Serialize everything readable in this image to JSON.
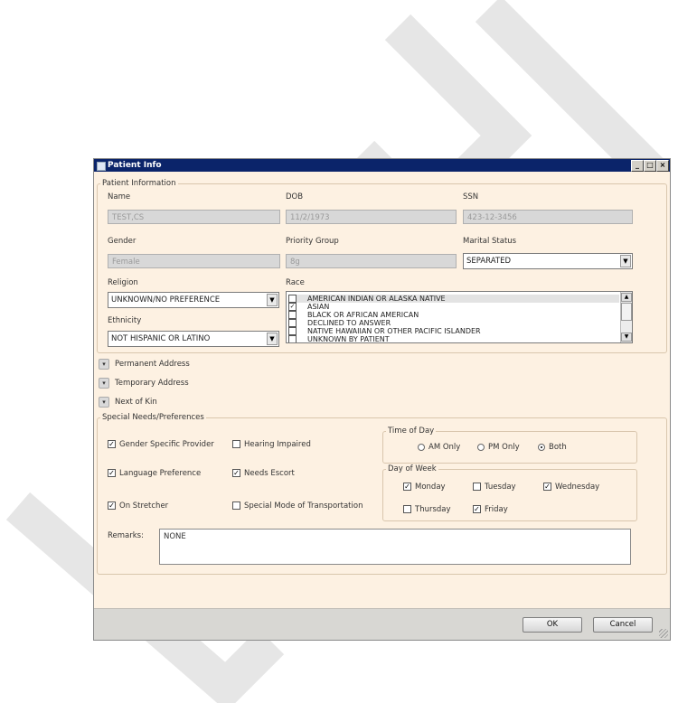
{
  "window": {
    "title": "Patient Info",
    "controls": {
      "minimize": "_",
      "maximize": "□",
      "close": "×"
    }
  },
  "patient_information": {
    "group_title": "Patient Information",
    "name_label": "Name",
    "name_value": "TEST,CS",
    "dob_label": "DOB",
    "dob_value": "11/2/1973",
    "ssn_label": "SSN",
    "ssn_value": "423-12-3456",
    "gender_label": "Gender",
    "gender_value": "Female",
    "priority_label": "Priority Group",
    "priority_value": "8g",
    "marital_label": "Marital Status",
    "marital_value": "SEPARATED",
    "religion_label": "Religion",
    "religion_value": "UNKNOWN/NO PREFERENCE",
    "ethnicity_label": "Ethnicity",
    "ethnicity_value": "NOT HISPANIC OR LATINO",
    "race_label": "Race",
    "race_options": [
      {
        "label": "AMERICAN INDIAN OR ALASKA NATIVE",
        "checked": false,
        "mark": ""
      },
      {
        "label": "ASIAN",
        "checked": true,
        "mark": "✓"
      },
      {
        "label": "BLACK OR AFRICAN AMERICAN",
        "checked": false,
        "mark": ""
      },
      {
        "label": "DECLINED TO ANSWER",
        "checked": false,
        "mark": ""
      },
      {
        "label": "NATIVE HAWAIIAN OR OTHER PACIFIC ISLANDER",
        "checked": false,
        "mark": ""
      },
      {
        "label": "UNKNOWN BY PATIENT",
        "checked": false,
        "mark": ""
      }
    ]
  },
  "sections": {
    "permanent_address": "Permanent Address",
    "temporary_address": "Temporary Address",
    "next_of_kin": "Next of Kin"
  },
  "special_needs": {
    "group_title": "Special Needs/Preferences",
    "gender_specific": {
      "label": "Gender Specific Provider",
      "checked": true,
      "mark": "✓"
    },
    "hearing_impaired": {
      "label": "Hearing Impaired",
      "checked": false,
      "mark": ""
    },
    "language_preference": {
      "label": "Language Preference",
      "checked": true,
      "mark": "✓"
    },
    "needs_escort": {
      "label": "Needs Escort",
      "checked": true,
      "mark": "✓"
    },
    "on_stretcher": {
      "label": "On Stretcher",
      "checked": true,
      "mark": "✓"
    },
    "special_transport": {
      "label": "Special Mode of Transportation",
      "checked": false,
      "mark": ""
    },
    "time_of_day": {
      "group_title": "Time of Day",
      "am": "AM Only",
      "pm": "PM Only",
      "both": "Both",
      "selected": "Both"
    },
    "day_of_week": {
      "group_title": "Day of Week",
      "monday": {
        "label": "Monday",
        "checked": true,
        "mark": "✓"
      },
      "tuesday": {
        "label": "Tuesday",
        "checked": false,
        "mark": ""
      },
      "wednesday": {
        "label": "Wednesday",
        "checked": true,
        "mark": "✓"
      },
      "thursday": {
        "label": "Thursday",
        "checked": false,
        "mark": ""
      },
      "friday": {
        "label": "Friday",
        "checked": true,
        "mark": "✓"
      }
    },
    "remarks_label": "Remarks:",
    "remarks_value": "NONE"
  },
  "buttons": {
    "ok": "OK",
    "cancel": "Cancel"
  },
  "glyphs": {
    "combo_arrow": "▼",
    "scroll_up": "▲",
    "scroll_down": "▼",
    "expand": "▾"
  },
  "colors": {
    "title_bar": "#0b246a",
    "panel_background": "#fdf1e2",
    "watermark": "#e8e8e8"
  }
}
